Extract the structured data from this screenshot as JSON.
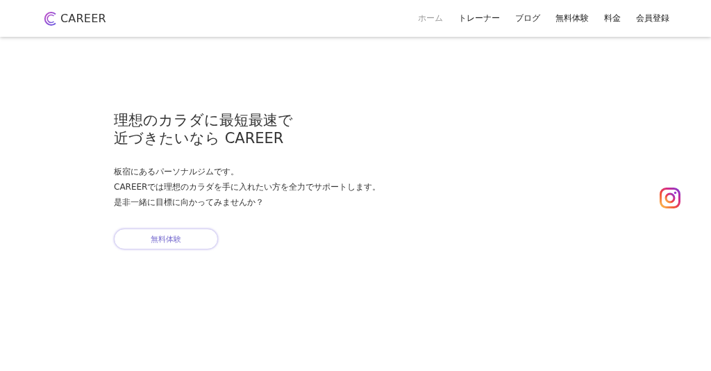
{
  "header": {
    "logo": "CAREER",
    "nav": [
      {
        "label": "ホーム",
        "selected": true
      },
      {
        "label": "トレーナー",
        "selected": false
      },
      {
        "label": "ブログ",
        "selected": false
      },
      {
        "label": "無料体験",
        "selected": false
      },
      {
        "label": "料金",
        "selected": false
      },
      {
        "label": "会員登録",
        "selected": false
      }
    ]
  },
  "hero": {
    "headline": [
      "理想のカラダに最短最速で",
      "近づきたいなら CAREER"
    ],
    "description": [
      "板宿にあるパーソナルジムです。",
      "CAREERでは理想のカラダを手に入れたい方を全力でサポートします。",
      "是非一緒に目標に向かってみませんか？"
    ],
    "button": "無料体験"
  }
}
